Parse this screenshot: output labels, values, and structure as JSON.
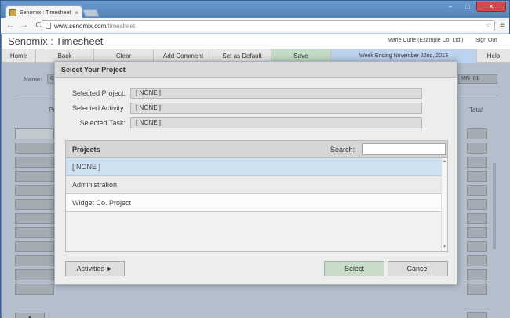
{
  "browser": {
    "tab_title": "Senomix : Timesheet",
    "tab_close": "×",
    "url_host": "www.senomix.com",
    "url_path": "/timesheet",
    "back": "←",
    "forward": "→",
    "reload": "C",
    "star": "☆",
    "menu": "≡",
    "minimize": "–",
    "maximize": "□",
    "close": "✕"
  },
  "app": {
    "title": "Senomix : Timesheet",
    "user": "Marie Curie  (Example Co. Ltd.)",
    "signout": "Sign Out"
  },
  "nav": {
    "home": "Home",
    "back": "Back",
    "clear": "Clear",
    "add_comment": "Add Comment",
    "set_default": "Set as Default",
    "save": "Save",
    "week": "Week Ending November 22nd, 2013",
    "help": "Help"
  },
  "background": {
    "name_label": "Name:",
    "name_value_start": "C",
    "name_value_end": "MN_01",
    "col_prefix": "Pr",
    "total_label": "Total",
    "up_button": "▲"
  },
  "modal": {
    "title": "Select Your Project",
    "selected_project_label": "Selected Project:",
    "selected_project_value": "[ NONE ]",
    "selected_activity_label": "Selected Activity:",
    "selected_activity_value": "[ NONE ]",
    "selected_task_label": "Selected Task:",
    "selected_task_value": "[ NONE ]",
    "projects_title": "Projects",
    "search_label": "Search:",
    "search_value": "",
    "projects": [
      "[ NONE ]",
      "Administration",
      "Widget Co. Project"
    ],
    "scroll_up": "▲",
    "scroll_down": "▼",
    "activities_button": "Activities ►",
    "select_button": "Select",
    "cancel_button": "Cancel"
  }
}
